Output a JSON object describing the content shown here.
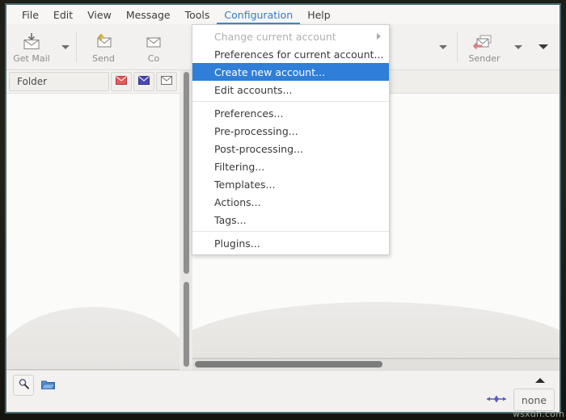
{
  "window": {
    "border_color": "#456a6d",
    "accent_color": "#2f7ed8"
  },
  "menubar": {
    "items": [
      {
        "label": "File",
        "active": false
      },
      {
        "label": "Edit",
        "active": false
      },
      {
        "label": "View",
        "active": false
      },
      {
        "label": "Message",
        "active": false
      },
      {
        "label": "Tools",
        "active": false
      },
      {
        "label": "Configuration",
        "active": true
      },
      {
        "label": "Help",
        "active": false
      }
    ]
  },
  "toolbar": {
    "buttons": [
      {
        "label": "Get Mail",
        "icon": "get-mail-icon"
      },
      {
        "label": "Send",
        "icon": "send-icon"
      },
      {
        "label": "Compose",
        "icon": "compose-icon",
        "truncated": "Co"
      },
      {
        "label": "Sender",
        "icon": "reply-sender-icon"
      }
    ]
  },
  "left_pane": {
    "column_header": "Folder",
    "header_buttons": [
      {
        "icon": "envelope-red-icon"
      },
      {
        "icon": "envelope-blue-icon"
      },
      {
        "icon": "envelope-plain-icon"
      }
    ]
  },
  "config_menu": {
    "items": [
      {
        "label": "Change current account",
        "disabled": true,
        "submenu": true,
        "highlighted": false,
        "separator_after": false
      },
      {
        "label": "Preferences for current account...",
        "disabled": false,
        "submenu": false,
        "highlighted": false,
        "separator_after": false
      },
      {
        "label": "Create new account...",
        "disabled": false,
        "submenu": false,
        "highlighted": true,
        "separator_after": false
      },
      {
        "label": "Edit accounts...",
        "disabled": false,
        "submenu": false,
        "highlighted": false,
        "separator_after": true
      },
      {
        "label": "Preferences...",
        "disabled": false,
        "submenu": false,
        "highlighted": false,
        "separator_after": false
      },
      {
        "label": "Pre-processing...",
        "disabled": false,
        "submenu": false,
        "highlighted": false,
        "separator_after": false
      },
      {
        "label": "Post-processing...",
        "disabled": false,
        "submenu": false,
        "highlighted": false,
        "separator_after": false
      },
      {
        "label": "Filtering...",
        "disabled": false,
        "submenu": false,
        "highlighted": false,
        "separator_after": false
      },
      {
        "label": "Templates...",
        "disabled": false,
        "submenu": false,
        "highlighted": false,
        "separator_after": false
      },
      {
        "label": "Actions...",
        "disabled": false,
        "submenu": false,
        "highlighted": false,
        "separator_after": false
      },
      {
        "label": "Tags...",
        "disabled": false,
        "submenu": false,
        "highlighted": false,
        "separator_after": true
      },
      {
        "label": "Plugins...",
        "disabled": false,
        "submenu": false,
        "highlighted": false,
        "separator_after": false
      }
    ]
  },
  "statusbar": {
    "search_icon": "magnifier-icon",
    "folder_icon": "folder-blue-icon",
    "collapse_icon": "triangle-up-icon",
    "divider_icon": "horizontal-resize-icon",
    "none_button_label": "none"
  },
  "watermark": {
    "text": "wsxdn.com"
  }
}
